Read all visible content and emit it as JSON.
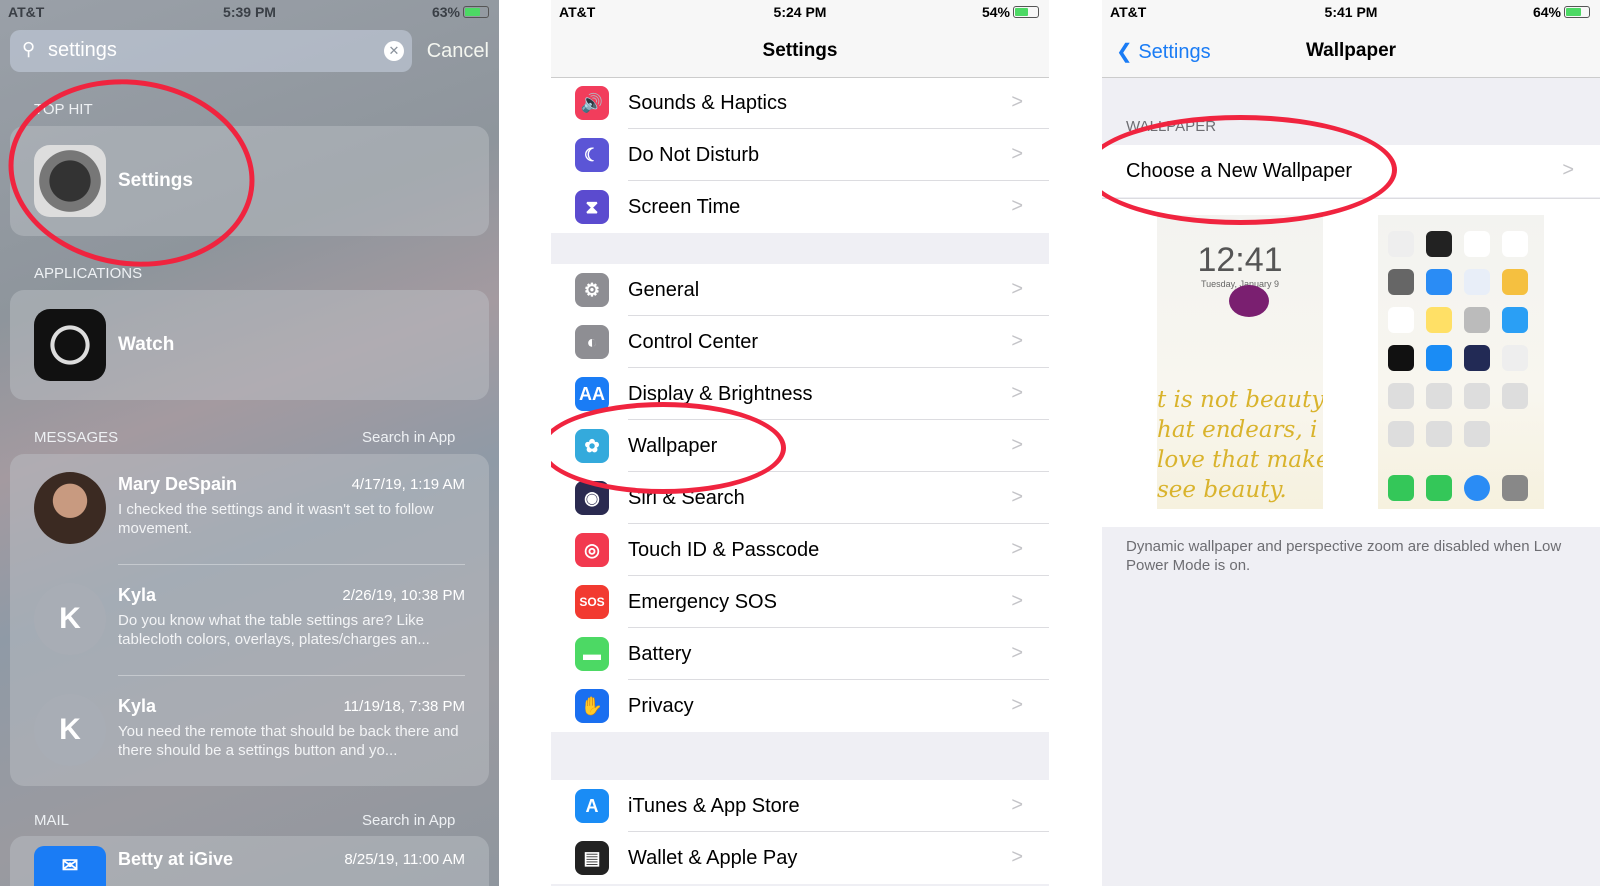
{
  "search_panel": {
    "status": {
      "carrier": "AT&T",
      "time": "5:39 PM",
      "battery": "63%",
      "battery_level": 0.63
    },
    "search": {
      "value": "settings",
      "cancel": "Cancel"
    },
    "top_hit": {
      "header": "TOP HIT",
      "title": "Settings"
    },
    "applications": {
      "header": "APPLICATIONS",
      "title": "Watch"
    },
    "messages": {
      "header": "MESSAGES",
      "search_in_app": "Search in App",
      "items": [
        {
          "name": "Mary DeSpain",
          "date": "4/17/19, 1:19 AM",
          "text": "I checked the settings and it wasn't set to follow movement.",
          "avatar": ""
        },
        {
          "name": "Kyla",
          "date": "2/26/19, 10:38 PM",
          "text": "Do you know what the table settings are? Like tablecloth colors, overlays, plates/charges an...",
          "avatar": "K"
        },
        {
          "name": "Kyla",
          "date": "11/19/18, 7:38 PM",
          "text": "You need the remote that should be back there and there should be a settings button and yo...",
          "avatar": "K"
        }
      ]
    },
    "mail": {
      "header": "MAIL",
      "search_in_app": "Search in App",
      "items": [
        {
          "name": "Betty at iGive",
          "date": "8/25/19, 11:00 AM"
        }
      ]
    }
  },
  "settings_panel": {
    "status": {
      "carrier": "AT&T",
      "time": "5:24 PM",
      "battery": "54%",
      "battery_level": 0.54
    },
    "title": "Settings",
    "groups": [
      [
        {
          "label": "Sounds & Haptics",
          "icon": "speaker-icon",
          "color": "#f23d5c"
        },
        {
          "label": "Do Not Disturb",
          "icon": "moon-icon",
          "color": "#5b55d6"
        },
        {
          "label": "Screen Time",
          "icon": "hourglass-icon",
          "color": "#5b4bcf"
        }
      ],
      [
        {
          "label": "General",
          "icon": "gear-icon",
          "color": "#8e8e93"
        },
        {
          "label": "Control Center",
          "icon": "toggles-icon",
          "color": "#8e8e93"
        },
        {
          "label": "Display & Brightness",
          "icon": "text-size-icon",
          "color": "#1a7cf5"
        },
        {
          "label": "Wallpaper",
          "icon": "flower-icon",
          "color": "#34aadc"
        },
        {
          "label": "Siri & Search",
          "icon": "siri-icon",
          "color": "#2a2a50"
        },
        {
          "label": "Touch ID & Passcode",
          "icon": "fingerprint-icon",
          "color": "#f2394f"
        },
        {
          "label": "Emergency SOS",
          "icon": "sos-icon",
          "color": "#f23a30"
        },
        {
          "label": "Battery",
          "icon": "battery-icon",
          "color": "#4cd964"
        },
        {
          "label": "Privacy",
          "icon": "hand-icon",
          "color": "#1a6ff0"
        }
      ],
      [
        {
          "label": "iTunes & App Store",
          "icon": "app-store-icon",
          "color": "#1a8cf5"
        },
        {
          "label": "Wallet & Apple Pay",
          "icon": "wallet-icon",
          "color": "#222"
        }
      ]
    ]
  },
  "wallpaper_panel": {
    "status": {
      "carrier": "AT&T",
      "time": "5:41 PM",
      "battery": "64%",
      "battery_level": 0.64
    },
    "back": "Settings",
    "title": "Wallpaper",
    "section": "WALLPAPER",
    "choose": "Choose a New Wallpaper",
    "lock_time": "12:41",
    "lock_date": "Tuesday, January 9",
    "quote": [
      "t is not beauty",
      "hat endears, i",
      "love that make",
      "see beauty."
    ],
    "footer": "Dynamic wallpaper and perspective zoom are disabled when Low Power Mode is on."
  },
  "colors": {
    "accent": "#1a7cf5",
    "annotation": "#f0243f"
  }
}
